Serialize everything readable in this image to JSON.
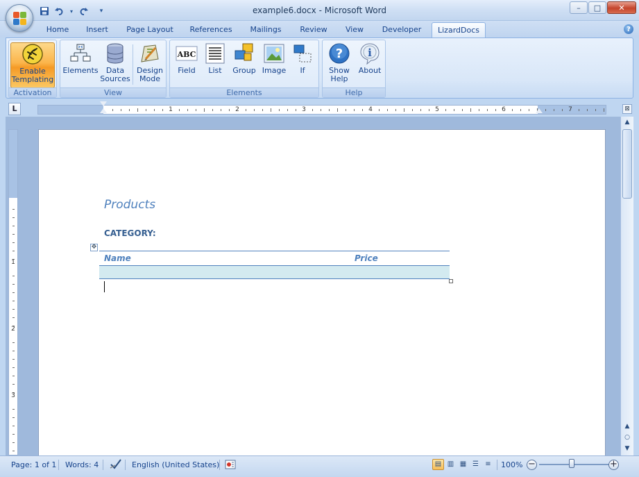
{
  "window": {
    "title": "example6.docx - Microsoft Word",
    "minimize_glyph": "–",
    "maximize_glyph": "□",
    "close_glyph": "✕"
  },
  "quick_access": {
    "save_icon": "save-icon",
    "undo_icon": "undo-icon",
    "redo_icon": "redo-icon",
    "customize_glyph": "▾"
  },
  "tabs": [
    {
      "label": "Home"
    },
    {
      "label": "Insert"
    },
    {
      "label": "Page Layout"
    },
    {
      "label": "References"
    },
    {
      "label": "Mailings"
    },
    {
      "label": "Review"
    },
    {
      "label": "View"
    },
    {
      "label": "Developer"
    },
    {
      "label": "LizardDocs",
      "active": true
    }
  ],
  "ribbon": {
    "groups": [
      {
        "label": "Activation",
        "buttons": [
          {
            "label1": "Enable",
            "label2": "Templating",
            "icon": "lizard-icon",
            "active": true
          }
        ]
      },
      {
        "label": "View",
        "buttons": [
          {
            "label1": "Elements",
            "label2": "",
            "icon": "elements-tree-icon"
          },
          {
            "label1": "Data",
            "label2": "Sources",
            "icon": "database-icon"
          },
          {
            "label1": "Design",
            "label2": "Mode",
            "icon": "design-mode-icon"
          }
        ]
      },
      {
        "label": "Elements",
        "buttons": [
          {
            "label1": "Field",
            "label2": "",
            "icon": "abc-field-icon",
            "glyph": "ABC"
          },
          {
            "label1": "List",
            "label2": "",
            "icon": "list-icon"
          },
          {
            "label1": "Group",
            "label2": "",
            "icon": "group-icon"
          },
          {
            "label1": "Image",
            "label2": "",
            "icon": "image-icon"
          },
          {
            "label1": "If",
            "label2": "",
            "icon": "if-icon"
          }
        ]
      },
      {
        "label": "Help",
        "buttons": [
          {
            "label1": "Show",
            "label2": "Help",
            "icon": "help-icon",
            "glyph": "?"
          },
          {
            "label1": "About",
            "label2": "",
            "icon": "info-icon",
            "glyph": "i"
          }
        ]
      }
    ],
    "help_glyph": "?"
  },
  "ruler": {
    "numbers": [
      "1",
      "2",
      "3",
      "4",
      "5",
      "6",
      "7"
    ],
    "vertical_numbers": [
      "1",
      "2",
      "3"
    ],
    "tab_selector": "L"
  },
  "document": {
    "title": "Products",
    "category_label": "CATEGORY:",
    "table": {
      "columns": [
        "Name",
        "Price"
      ],
      "rows": [
        [
          "",
          ""
        ]
      ]
    },
    "move_handle_glyph": "✥"
  },
  "statusbar": {
    "page": "Page: 1 of 1",
    "words": "Words: 4",
    "language": "English (United States)",
    "zoom": "100%",
    "zoom_out_glyph": "−",
    "zoom_in_glyph": "+"
  },
  "colors": {
    "accent": "#4f81bd",
    "heading": "#365f91",
    "table_fill": "#d3eaf0",
    "active_button": "#fbb44a"
  }
}
